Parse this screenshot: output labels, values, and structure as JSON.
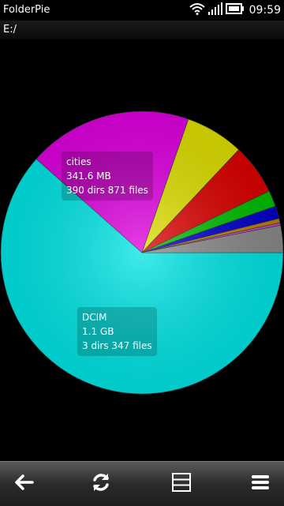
{
  "statusbar": {
    "app_title": "FolderPie",
    "time": "09:59",
    "icons": [
      "wifi-icon",
      "signal-icon",
      "battery-icon"
    ]
  },
  "path": "E:/",
  "chart_data": {
    "type": "pie",
    "slices": [
      {
        "name": "DCIM",
        "value": 63.5,
        "color": "#00e5e5",
        "size": "1.1 GB",
        "info": "3 dirs 347 files"
      },
      {
        "name": "cities",
        "value": 19.4,
        "color": "#e000e0",
        "size": "341.6 MB",
        "info": "390 dirs 871 files"
      },
      {
        "name": "",
        "value": 6.9,
        "color": "#e0e000"
      },
      {
        "name": "",
        "value": 6.0,
        "color": "#dd0000"
      },
      {
        "name": "",
        "value": 1.9,
        "color": "#00c000"
      },
      {
        "name": "",
        "value": 1.5,
        "color": "#0000cc"
      },
      {
        "name": "",
        "value": 0.5,
        "color": "#c08000"
      },
      {
        "name": "",
        "value": 0.3,
        "color": "#cc44cc"
      },
      {
        "name": "",
        "value": 3.2,
        "color": "#8a8a8a"
      }
    ]
  },
  "labels": [
    {
      "name": "cities",
      "size": "341.6 MB",
      "info": "390 dirs 871 files"
    },
    {
      "name": "DCIM",
      "size": "1.1 GB",
      "info": "3 dirs 347 files"
    }
  ],
  "toolbar": {
    "buttons": [
      "back-icon",
      "refresh-icon",
      "list-view-icon",
      "menu-icon"
    ]
  }
}
